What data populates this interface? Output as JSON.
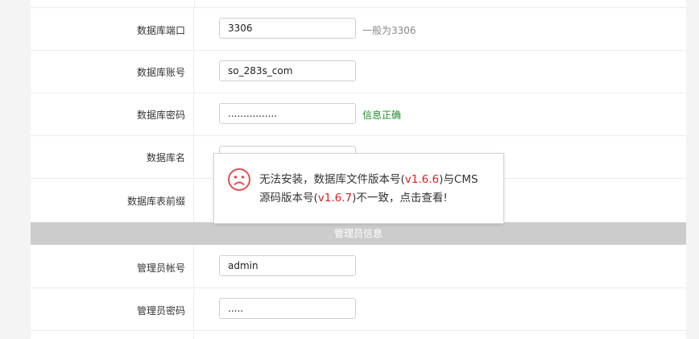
{
  "form": {
    "db_port": {
      "label": "数据库端口",
      "value": "3306",
      "hint": "一般为3306"
    },
    "db_user": {
      "label": "数据库账号",
      "value": "so_283s_com"
    },
    "db_password": {
      "label": "数据库密码",
      "value": "................",
      "hint": "信息正确"
    },
    "db_name": {
      "label": "数据库名",
      "value": ""
    },
    "db_prefix": {
      "label": "数据库表前缀",
      "value": ""
    },
    "admin_section_title": "管理员信息",
    "admin_user": {
      "label": "管理员帐号",
      "value": "admin"
    },
    "admin_password": {
      "label": "管理员密码",
      "value": "....."
    }
  },
  "toast": {
    "icon": "sad-face-icon",
    "line1_a": "无法安装，数据库文件版本号(",
    "db_version": "v1.6.6",
    "line1_b": ")与CMS",
    "line2_a": "源码版本号(",
    "cms_version": "v1.6.7",
    "line2_b": ")不一致，点击查看!",
    "colors": {
      "version": "#e02020",
      "icon": "#e05050"
    }
  },
  "colors": {
    "ok_hint": "#1f8f2f",
    "section_bg": "#cccccc"
  }
}
